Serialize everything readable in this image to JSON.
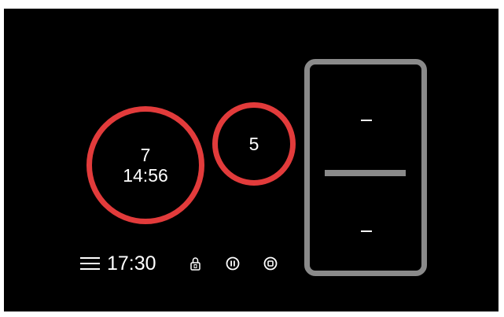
{
  "zones": [
    {
      "level": "7",
      "timer": "14:56"
    },
    {
      "level": "5"
    }
  ],
  "flex_zone": {
    "upper_level": "–",
    "lower_level": "–"
  },
  "status_bar": {
    "clock": "17:30",
    "menu_icon": "hamburger-menu",
    "lock_icon": "padlock",
    "pause_icon": "pause-circle",
    "stop_icon": "stop-circle"
  },
  "colors": {
    "active_zone": "#e23b3b",
    "inactive_zone": "#8a8a8a",
    "background": "#000000",
    "text": "#ffffff"
  }
}
